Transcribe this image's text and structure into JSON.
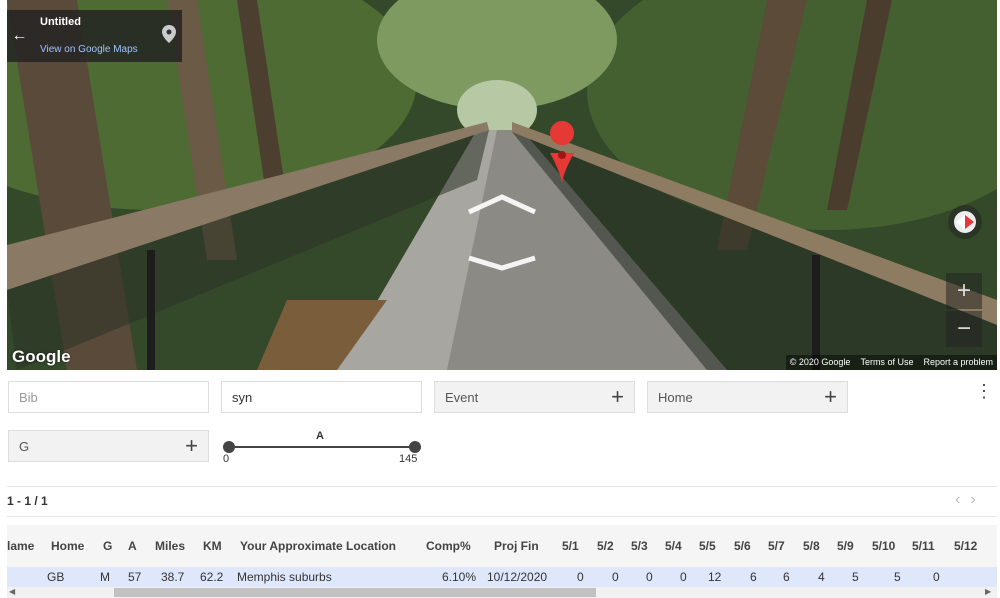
{
  "streetview": {
    "title": "Untitled",
    "link": "View on Google Maps",
    "logo": "Google",
    "footer": [
      "© 2020 Google",
      "Terms of Use",
      "Report a problem"
    ],
    "zoom_in": "+",
    "zoom_out": "−",
    "back_icon": "←",
    "icons": [
      "back-arrow-icon",
      "map-pin-icon",
      "compass-icon",
      "nav-arrow-icon"
    ]
  },
  "filters": {
    "bib": {
      "placeholder": "Bib",
      "value": ""
    },
    "name": {
      "value": "syn"
    },
    "event": {
      "label": "Event"
    },
    "home": {
      "label": "Home"
    },
    "gender": {
      "label": "G"
    },
    "plus": "+",
    "menu": "⋮",
    "age_slider": {
      "label": "A",
      "min": "0",
      "max": "145",
      "min_value": 0,
      "max_value": 145
    }
  },
  "pager": {
    "text": "1 - 1 / 1",
    "prev": "‹",
    "next": "›"
  },
  "table": {
    "headers": [
      "lame",
      "Home",
      "G",
      "A",
      "Miles",
      "KM",
      "Your Approximate Location",
      "Comp%",
      "Proj Fin",
      "5/1",
      "5/2",
      "5/3",
      "5/4",
      "5/5",
      "5/6",
      "5/7",
      "5/8",
      "5/9",
      "5/10",
      "5/11",
      "5/12"
    ],
    "rows": [
      [
        "",
        "GB",
        "M",
        "57",
        "38.7",
        "62.2",
        "Memphis suburbs",
        "6.10%",
        "10/12/2020",
        "0",
        "0",
        "0",
        "0",
        "12",
        "6",
        "6",
        "4",
        "5",
        "5",
        "0",
        ""
      ]
    ]
  },
  "colors": {
    "accent": "#dfe8fb",
    "pin": "#e53935"
  }
}
